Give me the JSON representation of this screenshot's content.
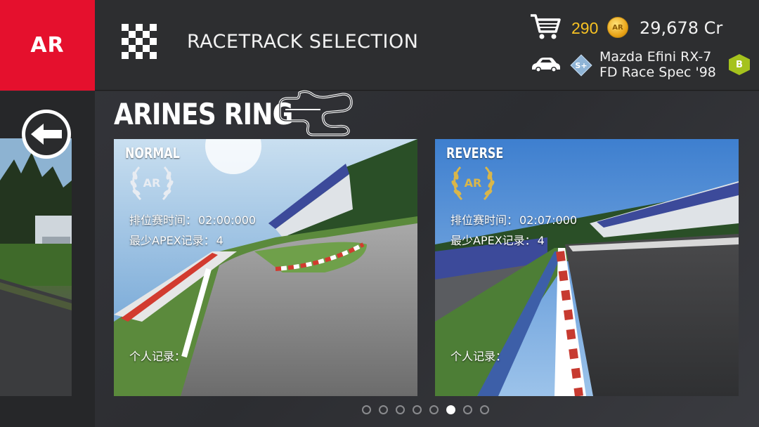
{
  "header": {
    "logo_text": "AR",
    "title": "RACETRACK SELECTION",
    "gold": "290",
    "credits": "29,678 Cr",
    "car_rank": "S+",
    "car_name_line1": "Mazda Efini RX-7",
    "car_name_line2": "FD Race Spec '98",
    "car_class": "B"
  },
  "track": {
    "name": "ARINES RING"
  },
  "cards": [
    {
      "mode": "NORMAL",
      "badge": "AR",
      "laurel_color": "#e8ecf2",
      "rank_time_label": "排位赛时间：",
      "rank_time_value": "02:00:000",
      "apex_label": "最少APEX记录：",
      "apex_value": "4",
      "personal_label": "个人记录："
    },
    {
      "mode": "REVERSE",
      "badge": "AR",
      "laurel_color": "#d9b64a",
      "rank_time_label": "排位赛时间：",
      "rank_time_value": "02:07:000",
      "apex_label": "最少APEX记录：",
      "apex_value": "4",
      "personal_label": "个人记录："
    }
  ],
  "pager": {
    "total": 8,
    "active_index": 5
  },
  "colors": {
    "brand_red": "#e5102d",
    "gold": "#f7c223",
    "class_green": "#a5c21d",
    "rank_blue": "#8fb4d6"
  },
  "icons": {
    "flag": "checkered-flag-icon",
    "cart": "shopping-cart-icon",
    "coin": "gold-coin-icon",
    "car": "car-icon",
    "back": "back-arrow-icon",
    "map": "track-map-icon"
  }
}
